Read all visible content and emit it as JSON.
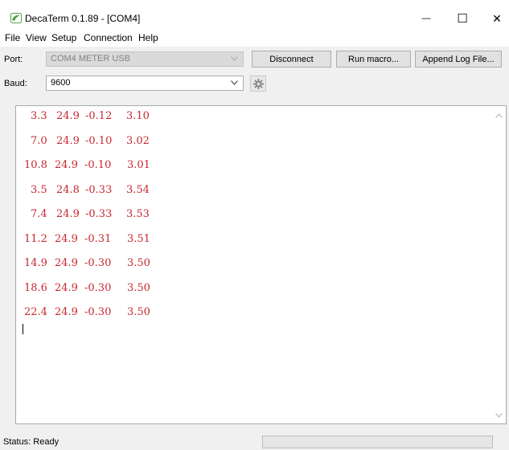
{
  "window": {
    "title": "DecaTerm 0.1.89 - [COM4]",
    "minimize_glyph": "—",
    "maximize_glyph": "☐",
    "close_glyph": "✕"
  },
  "menu": [
    "File",
    "View",
    "Setup",
    "Connection",
    "Help"
  ],
  "toolbar": {
    "port_label": "Port:",
    "port_value": "COM4 METER USB",
    "baud_label": "Baud:",
    "baud_value": "9600",
    "disconnect_label": "Disconnect",
    "run_macro_label": "Run macro...",
    "append_log_label": "Append Log File..."
  },
  "terminal": {
    "text_color": "#c6282e",
    "rows": [
      [
        "3.3",
        "24.9",
        "-0.12",
        "3.10"
      ],
      [
        "7.0",
        "24.9",
        "-0.10",
        "3.02"
      ],
      [
        "10.8",
        "24.9",
        "-0.10",
        "3.01"
      ],
      [
        "3.5",
        "24.8",
        "-0.33",
        "3.54"
      ],
      [
        "7.4",
        "24.9",
        "-0.33",
        "3.53"
      ],
      [
        "11.2",
        "24.9",
        "-0.31",
        "3.51"
      ],
      [
        "14.9",
        "24.9",
        "-0.30",
        "3.50"
      ],
      [
        "18.6",
        "24.9",
        "-0.30",
        "3.50"
      ],
      [
        "22.4",
        "24.9",
        "-0.30",
        "3.50"
      ]
    ]
  },
  "status": {
    "text": "Status: Ready",
    "progress": 0
  },
  "icons": {
    "app": "decaterm-logo-icon",
    "settings": "gear-icon"
  }
}
